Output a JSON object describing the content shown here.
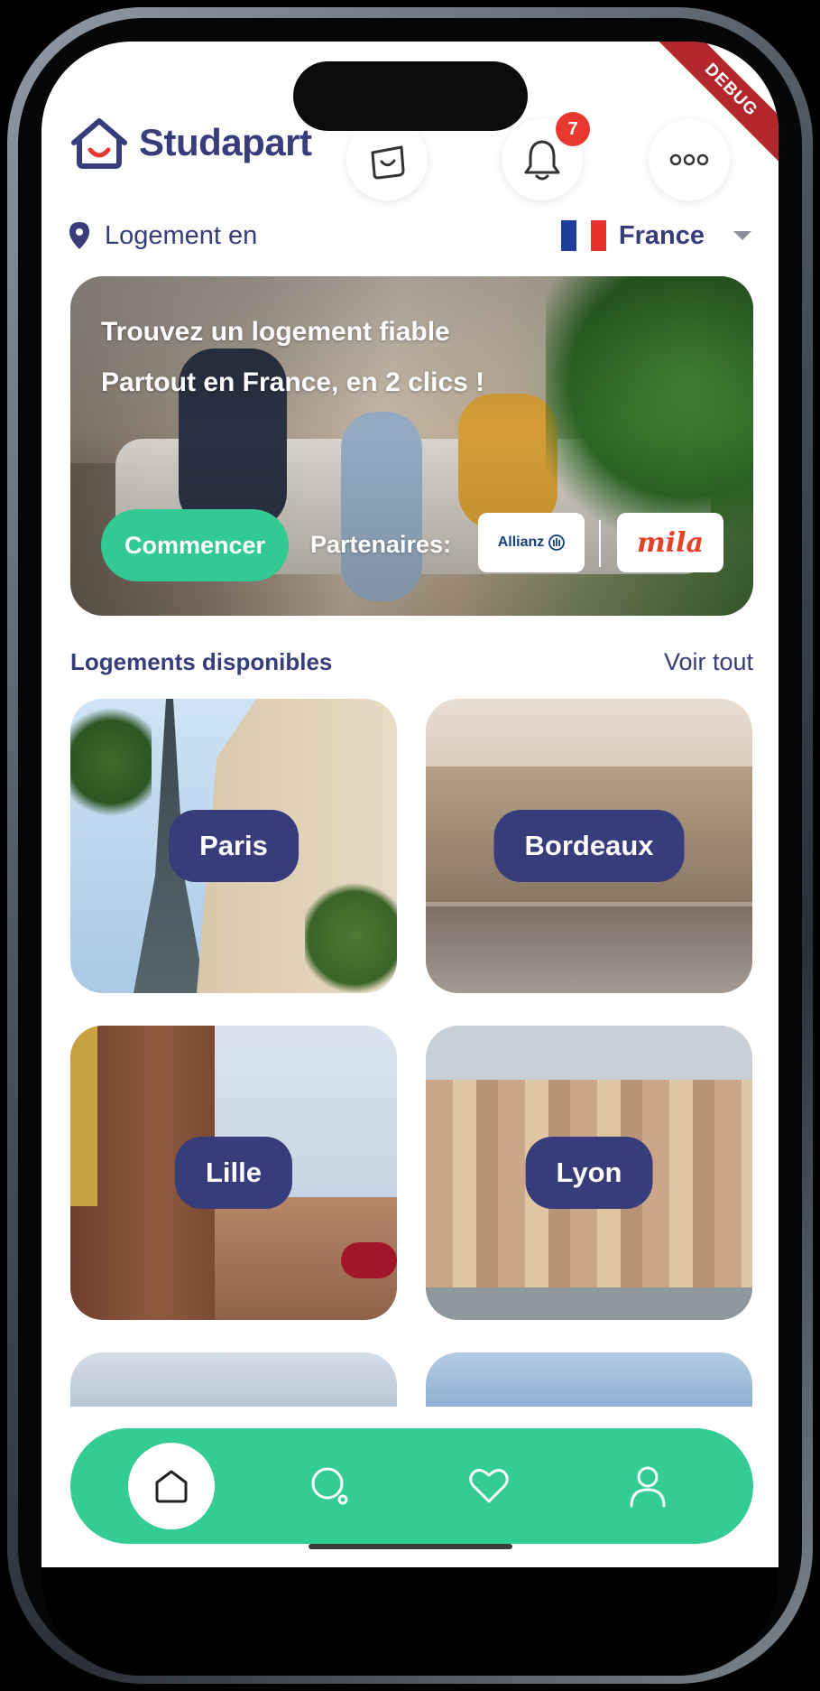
{
  "app": {
    "brand": "Studapart",
    "debug_ribbon": "DEBUG"
  },
  "header": {
    "notifications_count": "7",
    "cart_icon": "bag-icon",
    "bell_icon": "bell-icon",
    "more_icon": "more-dots-icon"
  },
  "location": {
    "label": "Logement en",
    "country": "France",
    "colors": {
      "flag_blue": "#1f3d9c",
      "flag_white": "#ffffff",
      "flag_red": "#e8302c"
    }
  },
  "hero": {
    "title_line1": "Trouvez un logement fiable",
    "title_line2": "Partout en France, en 2 clics !",
    "cta": "Commencer",
    "partners_label": "Partenaires:",
    "partners": [
      "Allianz",
      "mila"
    ]
  },
  "section": {
    "title": "Logements disponibles",
    "see_all": "Voir tout"
  },
  "cities": [
    {
      "name": "Paris"
    },
    {
      "name": "Bordeaux"
    },
    {
      "name": "Lille"
    },
    {
      "name": "Lyon"
    }
  ],
  "nav": {
    "items": [
      "home-icon",
      "search-icon",
      "heart-icon",
      "user-icon"
    ],
    "active": "home-icon"
  },
  "colors": {
    "brand_navy": "#363d7a",
    "accent_green": "#33cc95",
    "badge_red": "#e8382f"
  }
}
